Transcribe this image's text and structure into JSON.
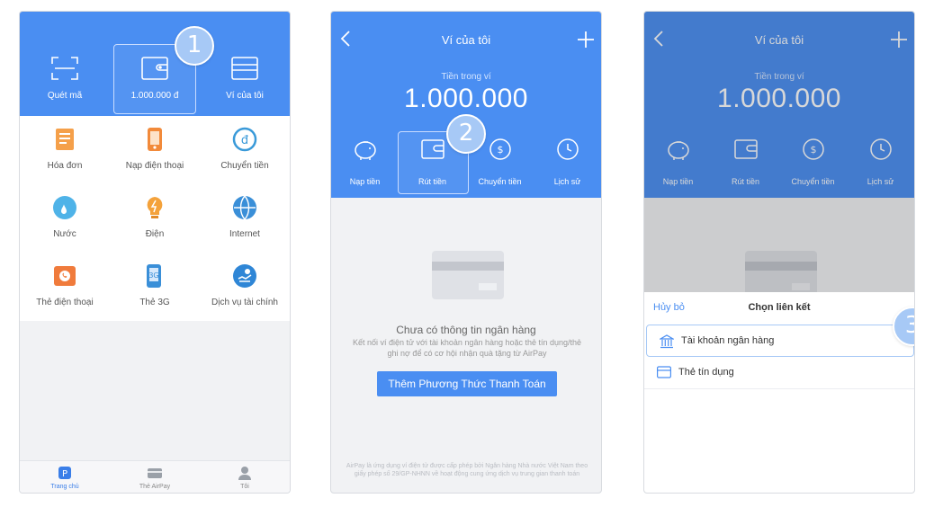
{
  "colors": {
    "primary_blue": "#4a8ef2",
    "badge": "#a7c9f6",
    "surface": "#f1f2f4"
  },
  "screen1": {
    "top_actions": [
      {
        "label": "Quét mã",
        "icon": "scan-icon"
      },
      {
        "label": "1.000.000 đ",
        "icon": "wallet-icon"
      },
      {
        "label": "Ví của tôi",
        "icon": "my-wallet-icon"
      }
    ],
    "step_badge": "1",
    "services": [
      {
        "label": "Hóa đơn",
        "icon": "bill-icon"
      },
      {
        "label": "Nạp điện thoại",
        "icon": "phone-topup-icon"
      },
      {
        "label": "Chuyển tiền",
        "icon": "transfer-icon"
      },
      {
        "label": "Nước",
        "icon": "water-icon"
      },
      {
        "label": "Điện",
        "icon": "electricity-icon"
      },
      {
        "label": "Internet",
        "icon": "internet-icon"
      },
      {
        "label": "Thẻ điện thoại",
        "icon": "phone-card-icon"
      },
      {
        "label": "Thẻ 3G",
        "icon": "3g-card-icon"
      },
      {
        "label": "Dịch vụ tài chính",
        "icon": "finance-icon"
      }
    ],
    "tabs": [
      {
        "label": "Trang chủ",
        "icon": "home-icon"
      },
      {
        "label": "Thẻ AirPay",
        "icon": "card-icon"
      },
      {
        "label": "Tôi",
        "icon": "user-icon"
      }
    ]
  },
  "wallet": {
    "title": "Ví của tôi",
    "balance_label": "Tiền trong ví",
    "balance": "1.000.000",
    "actions": [
      {
        "label": "Nạp tiền",
        "icon": "piggy-bank-icon"
      },
      {
        "label": "Rút tiền",
        "icon": "withdraw-icon"
      },
      {
        "label": "Chuyển tiền",
        "icon": "transfer-icon"
      },
      {
        "label": "Lịch sử",
        "icon": "clock-icon"
      }
    ]
  },
  "screen2": {
    "step_badge": "2",
    "empty_title": "Chưa có thông tin ngân hàng",
    "empty_desc": "Kết nối ví điện tử với tài khoản ngân hàng hoặc thẻ tín dụng/thẻ ghi nợ để có cơ hội nhận quà tặng từ AirPay",
    "add_button": "Thêm Phương Thức Thanh Toán",
    "footer": "AirPay là ứng dụng ví điện tử được cấp phép bởi Ngân hàng Nhà nước Việt Nam theo giấy phép số 29/GP-NHNN về hoạt động cung ứng dịch vụ trung gian thanh toán"
  },
  "screen3": {
    "step_badge": "3",
    "cancel": "Hủy bỏ",
    "sheet_title": "Chọn liên kết",
    "options": [
      {
        "label": "Tài khoản ngân hàng",
        "icon": "bank-icon"
      },
      {
        "label": "Thẻ tín dụng",
        "icon": "credit-card-icon"
      }
    ]
  }
}
